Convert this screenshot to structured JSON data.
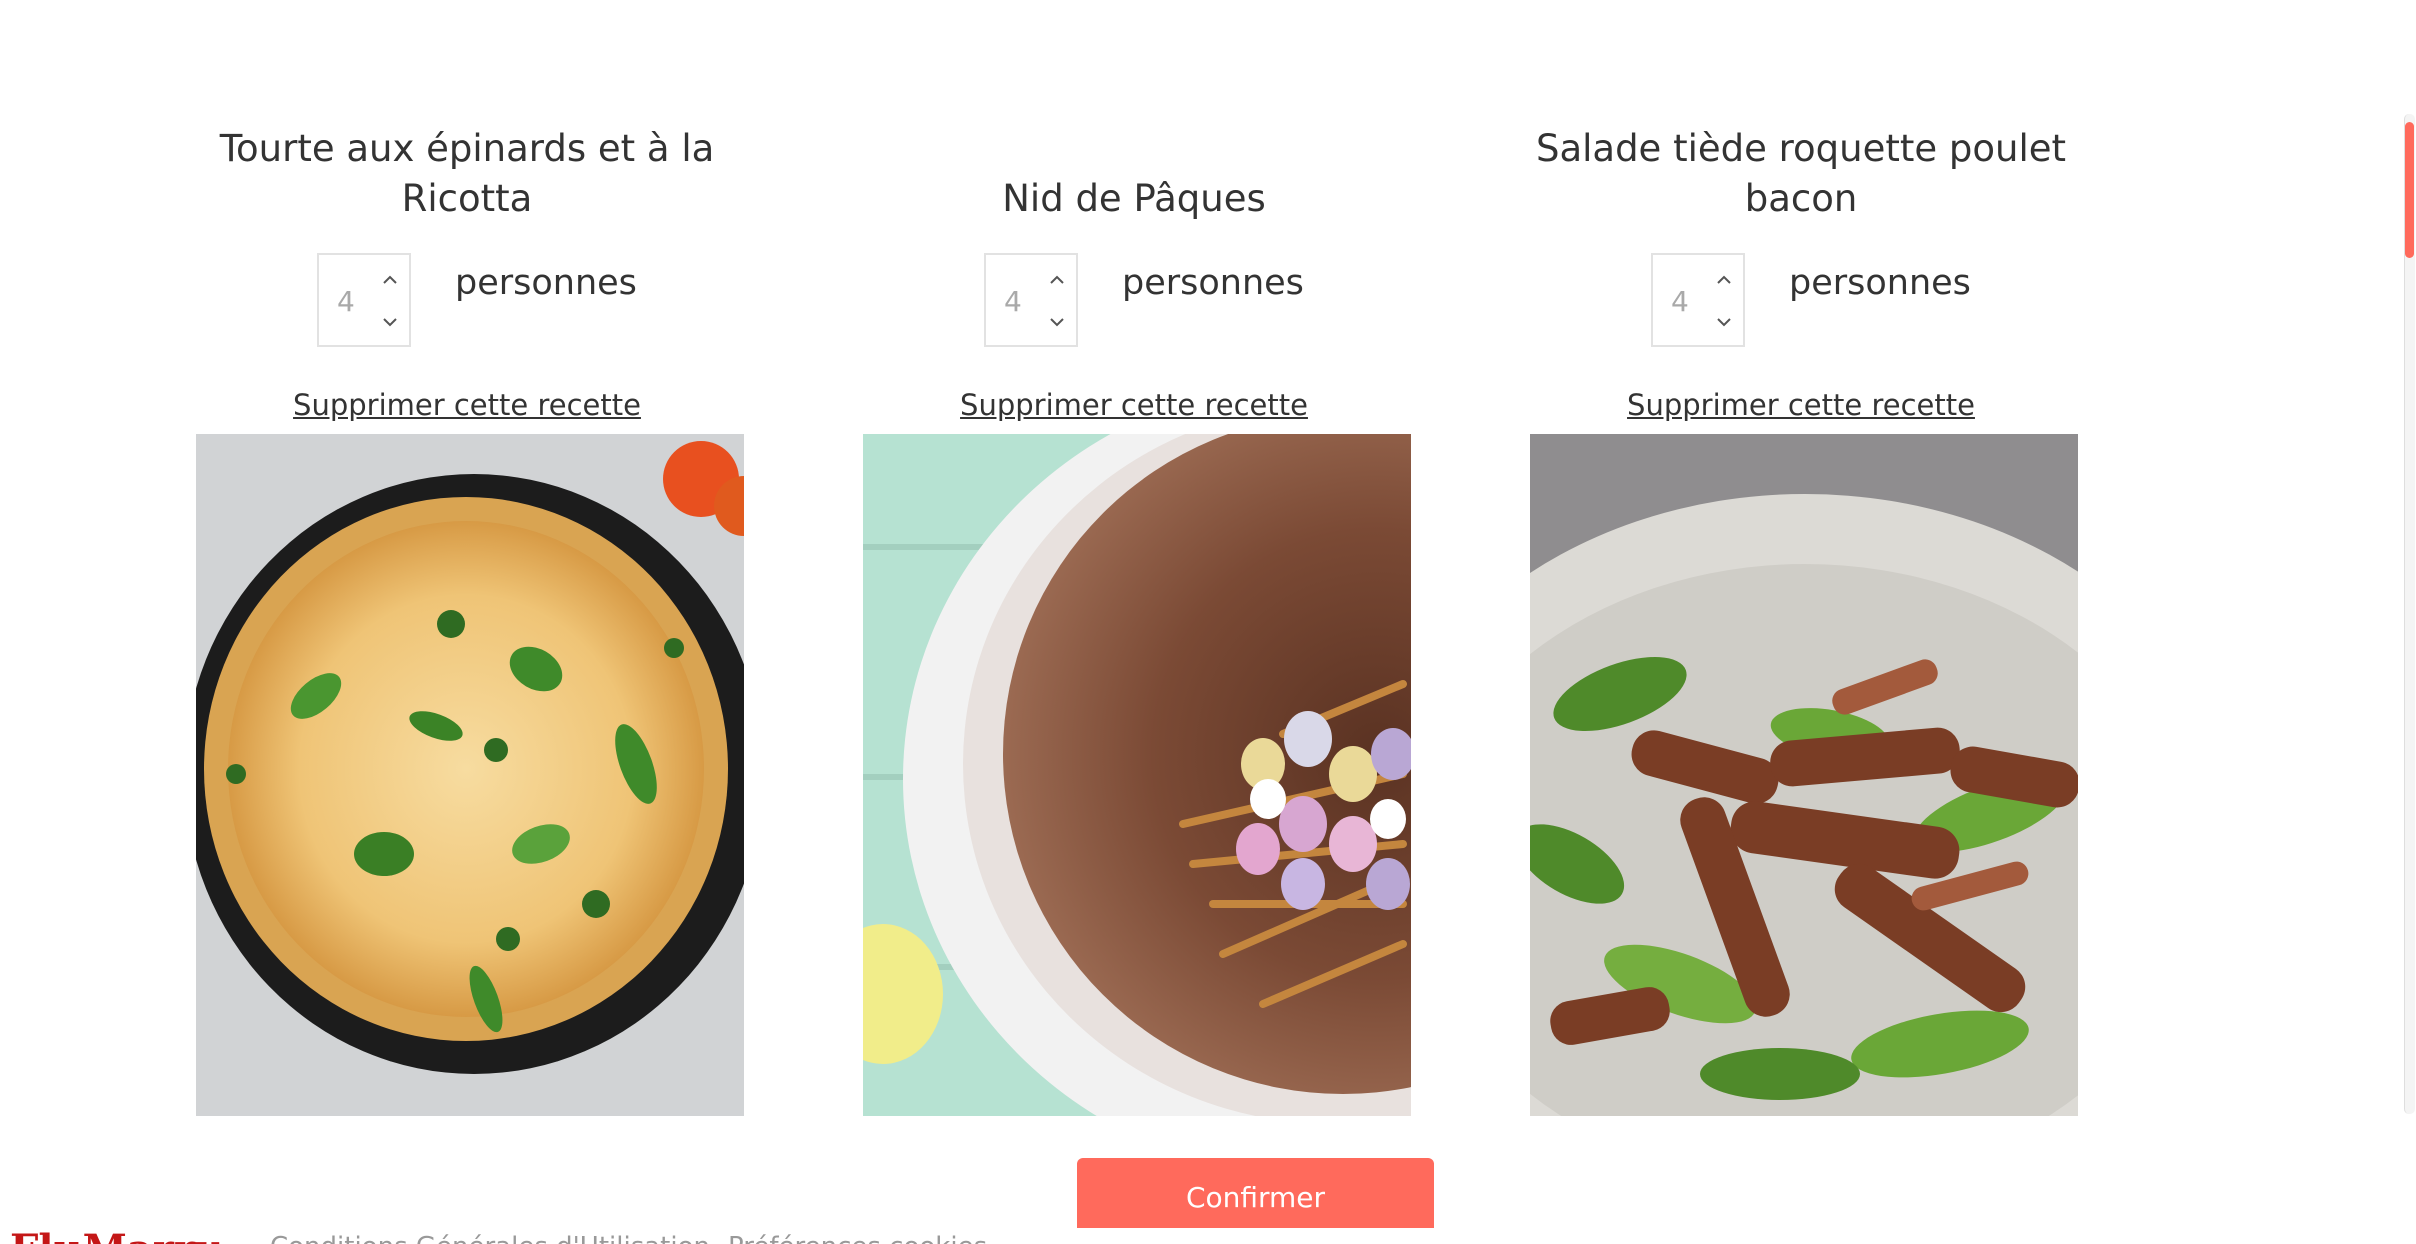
{
  "recipes": [
    {
      "title": "Tourte aux épinards et à la Ricotta",
      "servings": "4",
      "servings_label": "personnes",
      "remove_label": "Supprimer cette recette"
    },
    {
      "title": "Nid de Pâques",
      "servings": "4",
      "servings_label": "personnes",
      "remove_label": "Supprimer cette recette"
    },
    {
      "title": "Salade tiède roquette poulet bacon",
      "servings": "4",
      "servings_label": "personnes",
      "remove_label": "Supprimer cette recette"
    }
  ],
  "actions": {
    "confirm_label": "Confirmer"
  },
  "footer": {
    "logo": "FluMarry",
    "links": [
      "Conditions Générales d'Utilisation",
      "Préférences cookies"
    ]
  },
  "colors": {
    "accent": "#ff6a5c",
    "text": "#333333",
    "muted": "#a9a9a9"
  },
  "icons": {
    "stepper_up": "chevron-up-icon",
    "stepper_down": "chevron-down-icon"
  }
}
